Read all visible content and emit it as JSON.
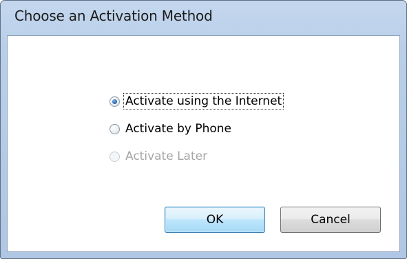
{
  "window": {
    "title": "Choose an Activation Method"
  },
  "options": [
    {
      "label": "Activate using the Internet",
      "checked": true,
      "enabled": true,
      "focused": true
    },
    {
      "label": "Activate by Phone",
      "checked": false,
      "enabled": true,
      "focused": false
    },
    {
      "label": "Activate Later",
      "checked": false,
      "enabled": false,
      "focused": false
    }
  ],
  "buttons": {
    "ok_label": "OK",
    "cancel_label": "Cancel"
  },
  "colors": {
    "titlebar": "#b9cfe9",
    "radio_selected": "#2d6bb5",
    "disabled_text": "#a5a5a5",
    "default_button_border": "#3c7fb1"
  }
}
